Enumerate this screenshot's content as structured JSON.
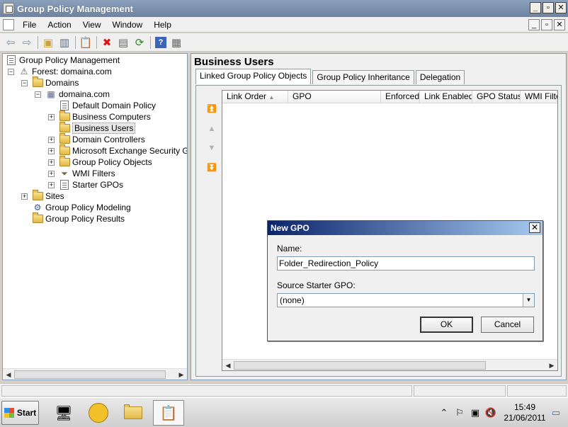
{
  "window": {
    "title": "Group Policy Management",
    "minimize": "_",
    "restore": "▫",
    "close": "✕"
  },
  "menu": [
    "File",
    "Action",
    "View",
    "Window",
    "Help"
  ],
  "toolbar_icons": [
    "back-icon",
    "forward-icon",
    "up-folder-icon",
    "show-hide-tree-icon",
    "clipboard-icon",
    "delete-icon",
    "properties-icon",
    "refresh-icon",
    "help-icon",
    "export-list-icon"
  ],
  "tree": {
    "root": "Group Policy Management",
    "forest": "Forest: domaina.com",
    "domains": "Domains",
    "domain": "domaina.com",
    "children": [
      "Default Domain Policy",
      "Business Computers",
      "Business Users",
      "Domain Controllers",
      "Microsoft Exchange Security Grou",
      "Group Policy Objects",
      "WMI Filters",
      "Starter GPOs"
    ],
    "sites": "Sites",
    "modeling": "Group Policy Modeling",
    "results": "Group Policy Results"
  },
  "main": {
    "title": "Business Users",
    "tabs": [
      "Linked Group Policy Objects",
      "Group Policy Inheritance",
      "Delegation"
    ],
    "columns": [
      "Link Order",
      "GPO",
      "Enforced",
      "Link Enabled",
      "GPO Status",
      "WMI Filte"
    ]
  },
  "dialog": {
    "title": "New GPO",
    "name_label": "Name:",
    "name_value": "Folder_Redirection_Policy",
    "source_label": "Source Starter GPO:",
    "source_value": "(none)",
    "ok": "OK",
    "cancel": "Cancel"
  },
  "taskbar": {
    "start": "Start",
    "time": "15:49",
    "date": "21/06/2011"
  }
}
